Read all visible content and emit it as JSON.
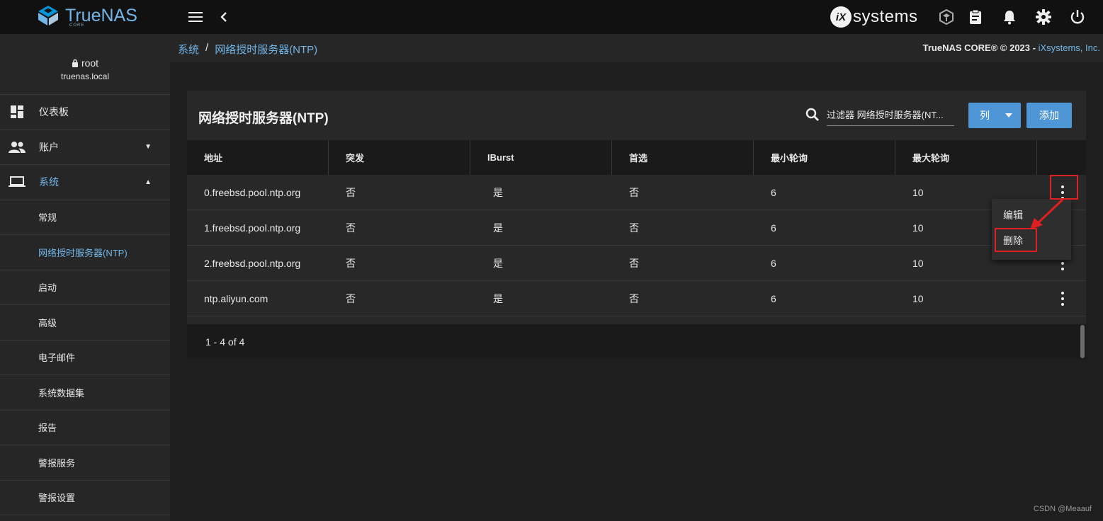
{
  "topbar": {
    "logo_text": "TrueNAS",
    "logo_sub": "CORE",
    "vendor_logo_mark": "iX",
    "vendor_logo_text": "systems"
  },
  "sidebar": {
    "user": "root",
    "host": "truenas.local",
    "items": [
      {
        "label": "仪表板",
        "icon": "dashboard-icon"
      },
      {
        "label": "账户",
        "icon": "people-icon"
      },
      {
        "label": "系统",
        "icon": "laptop-icon"
      },
      {
        "label": "常规"
      },
      {
        "label": "网络授时服务器(NTP)"
      },
      {
        "label": "启动"
      },
      {
        "label": "高级"
      },
      {
        "label": "电子邮件"
      },
      {
        "label": "系统数据集"
      },
      {
        "label": "报告"
      },
      {
        "label": "警报服务"
      },
      {
        "label": "警报设置"
      }
    ]
  },
  "breadcrumb": {
    "parent": "系统",
    "separator": "/",
    "current": "网络授时服务器(NTP)"
  },
  "copyright": {
    "text": "TrueNAS CORE® © 2023 - ",
    "link": "iXsystems, Inc."
  },
  "card": {
    "title": "网络授时服务器(NTP)",
    "filter_placeholder": "过滤器 网络授时服务器(NT...",
    "columns_button": "列",
    "add_button": "添加",
    "headers": [
      "地址",
      "突发",
      "IBurst",
      "首选",
      "最小轮询",
      "最大轮询"
    ],
    "rows": [
      [
        "0.freebsd.pool.ntp.org",
        "否",
        "是",
        "否",
        "6",
        "10"
      ],
      [
        "1.freebsd.pool.ntp.org",
        "否",
        "是",
        "否",
        "6",
        "10"
      ],
      [
        "2.freebsd.pool.ntp.org",
        "否",
        "是",
        "否",
        "6",
        "10"
      ],
      [
        "ntp.aliyun.com",
        "否",
        "是",
        "否",
        "6",
        "10"
      ]
    ],
    "pager": "1 - 4 of 4"
  },
  "menu": {
    "edit": "编辑",
    "delete": "删除"
  },
  "watermark": "CSDN @Meaauf",
  "colors": {
    "accent": "#71b6e8",
    "button": "#4e96d6",
    "highlight": "#e02020"
  }
}
